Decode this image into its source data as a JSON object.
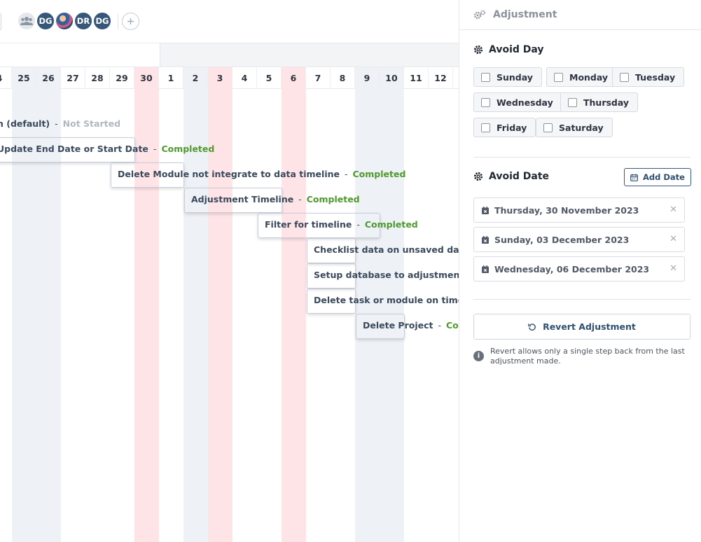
{
  "timeline": {
    "members": [
      "DG",
      "DR",
      "DG"
    ],
    "days": [
      {
        "label": "4",
        "kind": "normal"
      },
      {
        "label": "25",
        "kind": "weekend"
      },
      {
        "label": "26",
        "kind": "weekend"
      },
      {
        "label": "27",
        "kind": "normal"
      },
      {
        "label": "28",
        "kind": "normal"
      },
      {
        "label": "29",
        "kind": "normal"
      },
      {
        "label": "30",
        "kind": "avoid"
      },
      {
        "label": "1",
        "kind": "normal"
      },
      {
        "label": "2",
        "kind": "weekend"
      },
      {
        "label": "3",
        "kind": "avoid"
      },
      {
        "label": "4",
        "kind": "normal"
      },
      {
        "label": "5",
        "kind": "normal"
      },
      {
        "label": "6",
        "kind": "avoid"
      },
      {
        "label": "7",
        "kind": "normal"
      },
      {
        "label": "8",
        "kind": "normal"
      },
      {
        "label": "9",
        "kind": "weekend"
      },
      {
        "label": "10",
        "kind": "weekend"
      },
      {
        "label": "11",
        "kind": "normal"
      },
      {
        "label": "12",
        "kind": "normal"
      }
    ],
    "tasks": [
      {
        "name": "n (default)",
        "status": "Not Started",
        "state": "todo"
      },
      {
        "name": "Update End Date or Start Date",
        "status": "Completed",
        "state": "done"
      },
      {
        "name": "Delete Module not integrate to data timeline",
        "status": "Completed",
        "state": "done"
      },
      {
        "name": "Adjustment Timeline",
        "status": "Completed",
        "state": "done"
      },
      {
        "name": "Filter for timeline",
        "status": "Completed",
        "state": "done"
      },
      {
        "name": "Checklist data on unsaved data c",
        "status": "",
        "state": "done"
      },
      {
        "name": "Setup database to adjustment",
        "status": "",
        "state": "done"
      },
      {
        "name": "Delete task or module on timelin",
        "status": "",
        "state": "done"
      },
      {
        "name": "Delete Project",
        "status": "Com",
        "state": "done"
      }
    ],
    "separator": "-"
  },
  "panel": {
    "title": "Adjustment",
    "avoid_day": {
      "title": "Avoid Day",
      "days": [
        "Sunday",
        "Monday",
        "Tuesday",
        "Wednesday",
        "Thursday",
        "Friday",
        "Saturday"
      ]
    },
    "avoid_date": {
      "title": "Avoid Date",
      "add_label": "Add Date",
      "dates": [
        "Thursday, 30 November 2023",
        "Sunday, 03 December 2023",
        "Wednesday, 06 December 2023"
      ]
    },
    "revert_label": "Revert Adjustment",
    "revert_note": "Revert allows only a single step back from the last adjustment made."
  },
  "colors": {
    "completed": "#4f9a2c",
    "not_started": "#b1b8c1",
    "avoid_highlight": "#ffe4e7",
    "weekend_highlight": "#eef1f6",
    "accent": "#2f4f70"
  }
}
